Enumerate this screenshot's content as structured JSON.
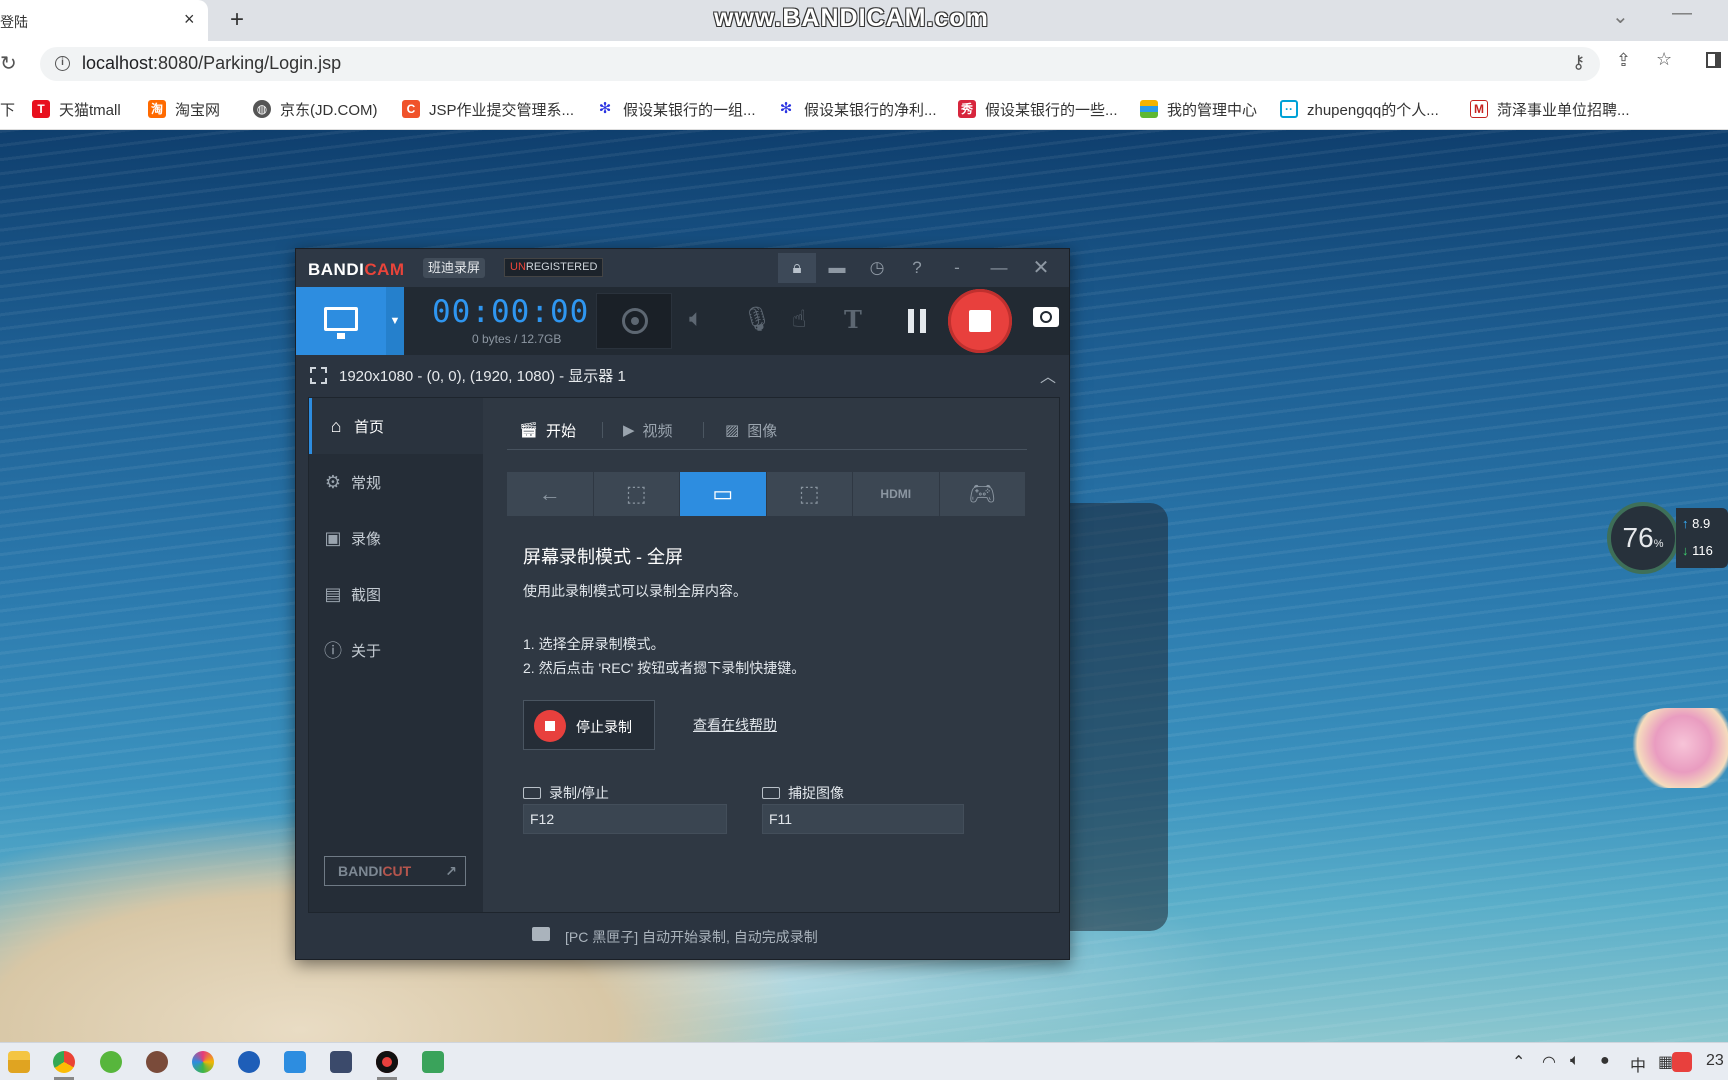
{
  "browser": {
    "tab_title": "登陆",
    "tab_close": "×",
    "new_tab": "+",
    "watermark": "www.BANDICAM.com",
    "minimize": "—",
    "url_host": "localhost",
    "url_path": ":8080/Parking/Login.jsp",
    "bookmarks": [
      {
        "label": "天猫tmall",
        "icon": "tmall-icon",
        "color": "#e8101e"
      },
      {
        "label": "淘宝网",
        "icon": "taobao-icon",
        "color": "#ff6a00"
      },
      {
        "label": "京东(JD.COM)",
        "icon": "globe-icon",
        "color": "#555555"
      },
      {
        "label": "JSP作业提交管理系...",
        "icon": "c-icon",
        "color": "#f0532b"
      },
      {
        "label": "假设某银行的一组...",
        "icon": "baidu-paw-icon",
        "color": "#2932e1"
      },
      {
        "label": "假设某银行的净利...",
        "icon": "baidu-paw-icon",
        "color": "#2932e1"
      },
      {
        "label": "假设某银行的一些...",
        "icon": "xiu-icon",
        "color": "#d7263d"
      },
      {
        "label": "我的管理中心",
        "icon": "stack-icon",
        "color": "#f6b400"
      },
      {
        "label": "zhupengqq的个人...",
        "icon": "bilibili-tv-icon",
        "color": "#00a1d6"
      },
      {
        "label": "菏泽事业单位招聘...",
        "icon": "gmail-icon",
        "color": "#c5221f"
      }
    ]
  },
  "bandicam": {
    "logo_a": "BANDI",
    "logo_b": "CAM",
    "cn_name": "班迪录屏",
    "unreg_a": "UN",
    "unreg_b": "REGISTERED",
    "timer": "00:00:00",
    "bytes": "0 bytes / 12.7GB",
    "area_text": "1920x1080 - (0, 0), (1920, 1080) - 显示器 1",
    "sidebar": [
      {
        "label": "首页",
        "icon": "home-icon",
        "active": true
      },
      {
        "label": "常规",
        "icon": "gear-icon",
        "active": false
      },
      {
        "label": "录像",
        "icon": "video-settings-icon",
        "active": false
      },
      {
        "label": "截图",
        "icon": "image-settings-icon",
        "active": false
      },
      {
        "label": "关于",
        "icon": "info-icon",
        "active": false
      }
    ],
    "bandicut_a": "BANDI",
    "bandicut_b": "CUT",
    "tabs": [
      {
        "label": "开始",
        "icon": "clapper-icon",
        "active": true
      },
      {
        "label": "视频",
        "icon": "video-folder-icon",
        "active": false
      },
      {
        "label": "图像",
        "icon": "picture-icon",
        "active": false
      }
    ],
    "modes": [
      "back-arrow-icon",
      "cursor-area-icon",
      "fullscreen-monitor-icon",
      "select-region-icon",
      "hdmi-device-icon",
      "gamepad-icon"
    ],
    "heading": "屏幕录制模式 - 全屏",
    "desc": "使用此录制模式可以录制全屏内容。",
    "step1": "1. 选择全屏录制模式。",
    "step2": "2. 然后点击 'REC' 按钮或者摁下录制快捷键。",
    "stop_label": "停止录制",
    "help_link": "查看在线帮助",
    "hotkey_rec_label": "录制/停止",
    "hotkey_rec_value": "F12",
    "hotkey_cap_label": "捕捉图像",
    "hotkey_cap_value": "F11",
    "status": "[PC 黑匣子] 自动开始录制, 自动完成录制"
  },
  "widget": {
    "percent": "76",
    "percent_unit": "%",
    "upload": "8.9",
    "download": "116"
  },
  "taskbar": {
    "ime": "中",
    "clock": "23"
  },
  "colors": {
    "accent": "#2d8de0",
    "record": "#e8403d",
    "window_bg": "#2b3440"
  }
}
